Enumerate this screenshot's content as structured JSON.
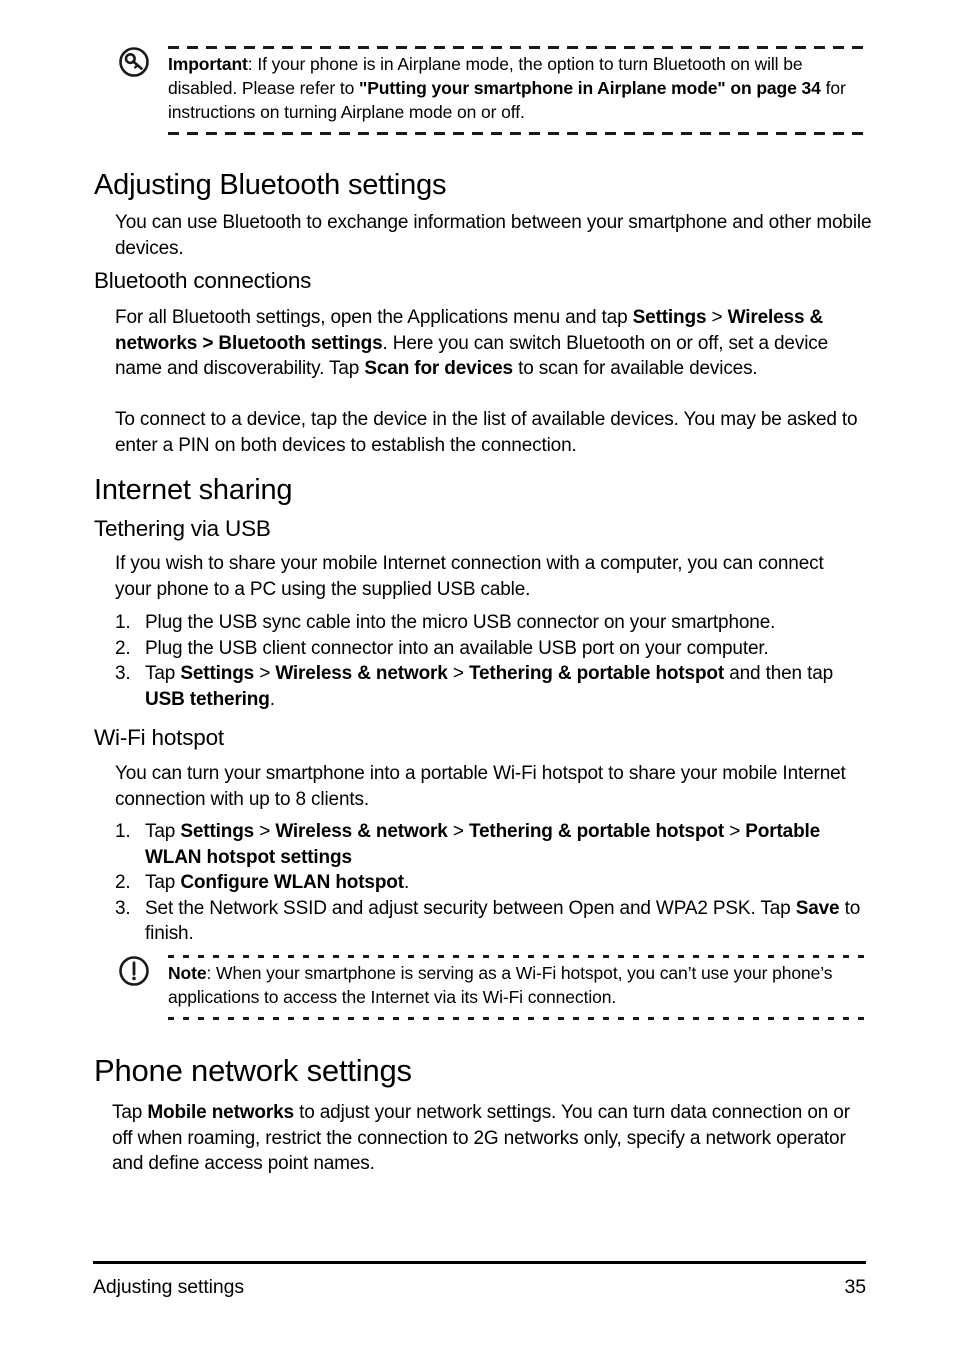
{
  "page": {
    "number": "35",
    "footer_chapter": "Adjusting settings"
  },
  "important_callout": {
    "icon": "key-in-circle-icon",
    "label": "Important",
    "line1_prefix": ": If your phone is in Airplane mode, the option to turn Bluetooth on will be",
    "line2_prefix": "disabled. Please refer to ",
    "line2_bold": "\"Putting your smartphone in Airplane mode\" on page 34",
    "line2_suffix": " for",
    "line3": "instructions on turning Airplane mode on or off."
  },
  "bluetooth_section": {
    "heading": "Adjusting Bluetooth settings",
    "intro": "You can use Bluetooth to exchange information between your smartphone and other mobile devices.",
    "subheading": "Bluetooth connections",
    "para1_a": "For all Bluetooth settings, open the Applications menu and tap ",
    "para1_b1": "Settings",
    "para1_c": " > ",
    "para1_b2": "Wireless & networks > Bluetooth settings",
    "para1_d": ". Here you can switch Bluetooth on or off, set a device name and discoverability. Tap ",
    "para1_b3": "Scan for devices",
    "para1_e": " to scan for available devices.",
    "para2": "To connect to a device, tap the device in the list of available devices. You may be asked to enter a PIN on both devices to establish the connection."
  },
  "internet_sharing": {
    "heading": "Internet sharing",
    "usb": {
      "subheading": "Tethering via USB",
      "intro": "If you wish to share your mobile Internet connection with a computer, you can connect your phone to a PC using the supplied USB cable.",
      "steps": [
        {
          "parts": [
            {
              "text": "Plug the USB sync cable into the micro USB connector on your smartphone.",
              "bold": false
            }
          ]
        },
        {
          "parts": [
            {
              "text": "Plug the USB client connector into an available USB port on your computer.",
              "bold": false
            }
          ]
        },
        {
          "parts": [
            {
              "text": "Tap ",
              "bold": false
            },
            {
              "text": "Settings",
              "bold": true
            },
            {
              "text": " > ",
              "bold": false
            },
            {
              "text": "Wireless & network",
              "bold": true
            },
            {
              "text": " > ",
              "bold": false
            },
            {
              "text": "Tethering & portable hotspot",
              "bold": true
            },
            {
              "text": " and then tap ",
              "bold": false
            },
            {
              "text": "USB tethering",
              "bold": true
            },
            {
              "text": ".",
              "bold": false
            }
          ]
        }
      ]
    },
    "wifi": {
      "subheading": "Wi-Fi hotspot",
      "intro": "You can turn your smartphone into a portable Wi-Fi hotspot to share your mobile Internet connection with up to 8 clients.",
      "steps": [
        {
          "parts": [
            {
              "text": "Tap ",
              "bold": false
            },
            {
              "text": "Settings",
              "bold": true
            },
            {
              "text": " > ",
              "bold": false
            },
            {
              "text": "Wireless & network",
              "bold": true
            },
            {
              "text": " > ",
              "bold": false
            },
            {
              "text": "Tethering & portable hotspot",
              "bold": true
            },
            {
              "text": " > ",
              "bold": false
            },
            {
              "text": "Portable WLAN hotspot settings",
              "bold": true
            }
          ]
        },
        {
          "parts": [
            {
              "text": "Tap ",
              "bold": false
            },
            {
              "text": "Configure WLAN hotspot",
              "bold": true
            },
            {
              "text": ".",
              "bold": false
            }
          ]
        },
        {
          "parts": [
            {
              "text": "Set the Network SSID and adjust security between Open and WPA2 PSK. Tap ",
              "bold": false
            },
            {
              "text": "Save",
              "bold": true
            },
            {
              "text": " to finish.",
              "bold": false
            }
          ]
        }
      ]
    }
  },
  "note_callout": {
    "icon": "exclamation-in-circle-icon",
    "label": "Note",
    "line1_suffix": ": When your smartphone is serving as a Wi-Fi hotspot, you can’t use your phone’s",
    "line2": "applications to access the Internet via its Wi-Fi connection."
  },
  "phone_network": {
    "heading": "Phone network settings",
    "para_a": "Tap ",
    "para_bold": "Mobile networks",
    "para_b": " to adjust your network settings. You can turn data connection on or off when roaming, restrict the connection to 2G networks only, specify a network operator and define access point names."
  },
  "colors": {
    "text": "#000000",
    "rule": "#1a1a1a"
  }
}
